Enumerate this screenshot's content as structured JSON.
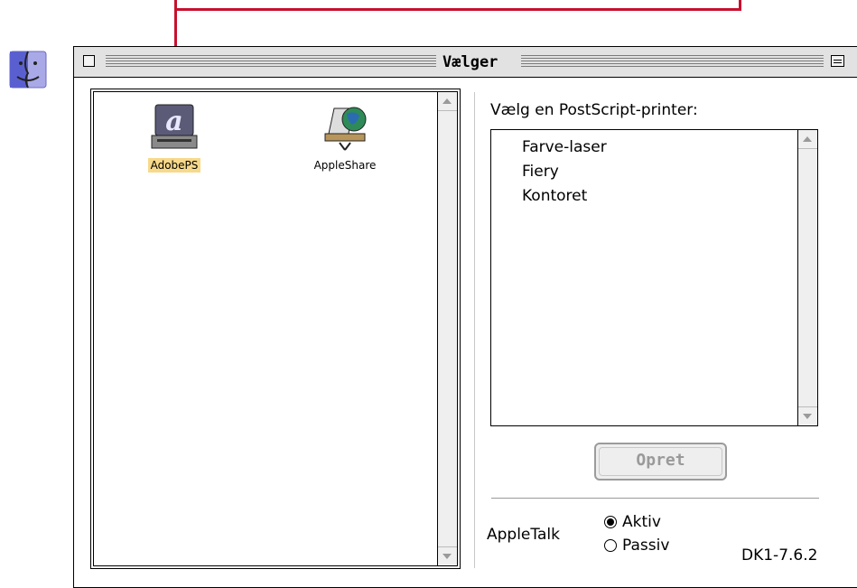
{
  "window": {
    "title": "Vælger"
  },
  "left_pane": {
    "items": [
      {
        "label": "AdobePS",
        "icon": "adobe-ps-printer-icon",
        "selected": true
      },
      {
        "label": "AppleShare",
        "icon": "appleshare-icon",
        "selected": false
      }
    ]
  },
  "right_pane": {
    "list_heading": "Vælg en PostScript-printer:",
    "printers": [
      "Farve-laser",
      "Fiery",
      "Kontoret"
    ],
    "create_button": "Opret",
    "appletalk_label": "AppleTalk",
    "radio_active": "Aktiv",
    "radio_passive": "Passiv",
    "appletalk_state": "Aktiv",
    "version": "DK1-7.6.2"
  },
  "colors": {
    "callout": "#c8102e",
    "selection": "#f7d98a",
    "titlebar": "#e2e2e2"
  }
}
